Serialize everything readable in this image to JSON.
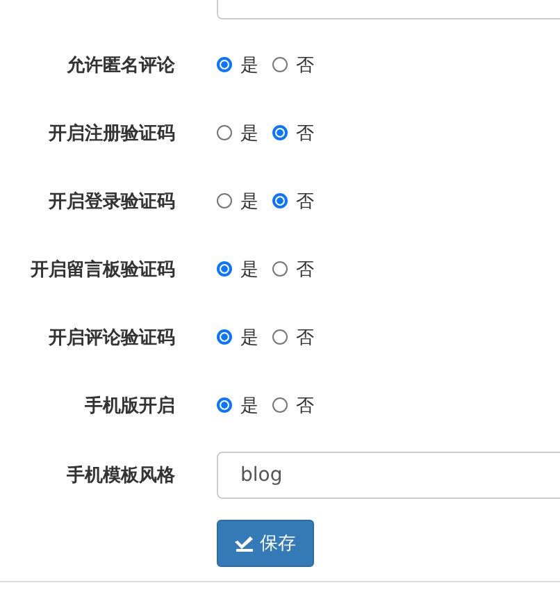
{
  "settings": [
    {
      "label": "允许匿名评论",
      "options": [
        {
          "label": "是",
          "selected": true
        },
        {
          "label": "否",
          "selected": false
        }
      ]
    },
    {
      "label": "开启注册验证码",
      "options": [
        {
          "label": "是",
          "selected": false
        },
        {
          "label": "否",
          "selected": true
        }
      ]
    },
    {
      "label": "开启登录验证码",
      "options": [
        {
          "label": "是",
          "selected": false
        },
        {
          "label": "否",
          "selected": true
        }
      ]
    },
    {
      "label": "开启留言板验证码",
      "options": [
        {
          "label": "是",
          "selected": true
        },
        {
          "label": "否",
          "selected": false
        }
      ]
    },
    {
      "label": "开启评论验证码",
      "options": [
        {
          "label": "是",
          "selected": true
        },
        {
          "label": "否",
          "selected": false
        }
      ]
    },
    {
      "label": "手机版开启",
      "options": [
        {
          "label": "是",
          "selected": true
        },
        {
          "label": "否",
          "selected": false
        }
      ]
    }
  ],
  "template_style": {
    "label": "手机模板风格",
    "value": "blog"
  },
  "save_button": {
    "label": "保存"
  }
}
